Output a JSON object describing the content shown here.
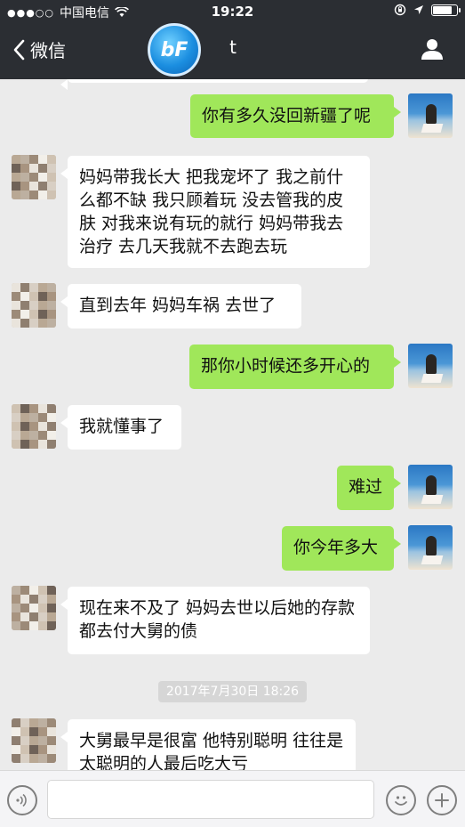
{
  "status_bar": {
    "carrier": "中国电信",
    "time": "19:22",
    "battery_level": 0.85
  },
  "nav": {
    "back_label": "微信",
    "title": "t",
    "logo_text": "bF"
  },
  "messages": [
    {
      "side": "out",
      "text": "你有多久没回新疆了呢"
    },
    {
      "side": "in",
      "text": "妈妈带我长大 把我宠坏了 我之前什么都不缺 我只顾着玩 没去管我的皮肤 对我来说有玩的就行 妈妈带我去治疗 去几天我就不去跑去玩"
    },
    {
      "side": "in",
      "text": "直到去年 妈妈车祸 去世了"
    },
    {
      "side": "out",
      "text": "那你小时候还多开心的"
    },
    {
      "side": "in",
      "text": "我就懂事了"
    },
    {
      "side": "out",
      "text": "难过"
    },
    {
      "side": "out",
      "text": "你今年多大"
    },
    {
      "side": "in",
      "text": "现在来不及了 妈妈去世以后她的存款 都去付大舅的债"
    },
    {
      "side": "in",
      "text": "大舅最早是很富 他特别聪明 往往是太聪明的人最后吃大亏"
    }
  ],
  "timestamp": "2017年7月30日 18:26",
  "icons": {
    "voice": "voice-icon",
    "emoji": "emoji-icon",
    "add": "plus-icon",
    "profile": "person-icon",
    "back": "chevron-left-icon"
  },
  "colors": {
    "nav_bg": "#2b2e33",
    "chat_bg": "#ebebeb",
    "outgoing_bubble": "#a0e75a",
    "incoming_bubble": "#ffffff"
  }
}
